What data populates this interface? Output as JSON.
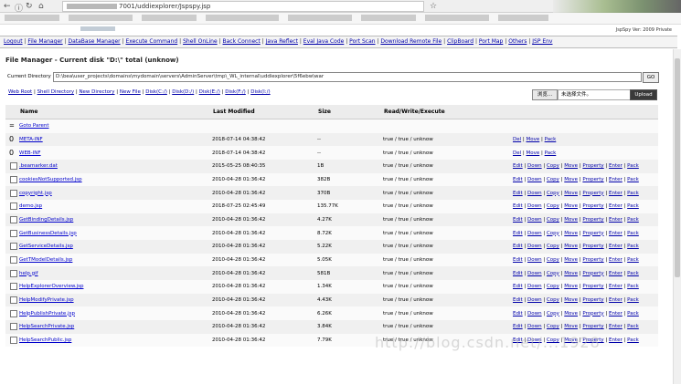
{
  "browser": {
    "url_suffix": "7001/uddiexplorer/Jspspy.jsp",
    "back_icon": "back-arrow-icon",
    "refresh_icon": "refresh-icon",
    "home_icon": "home-icon"
  },
  "page": {
    "blurred_link": "jspy",
    "version": "JspSpy Ver: 2009 Private"
  },
  "menu": [
    "Logout",
    "File Manager",
    "DataBase Manager",
    "Execute Command",
    "Shell OnLine",
    "Back Connect",
    "Java Reflect",
    "Eval Java Code",
    "Port Scan",
    "Download Remote File",
    "ClipBoard",
    "Port Map",
    "Others",
    "JSP Env"
  ],
  "file_manager": {
    "title": "File Manager - Current disk \"D:\\\" total (unknow)",
    "current_directory_label": "Current Directory",
    "current_directory_value": "D:\\bea\\user_projects\\domains\\mydomain\\servers\\AdminServer\\tmp\\_WL_internal\\uddiexplorer\\5f6ebw\\war",
    "go_label": "GO",
    "toolbar": [
      "Web Root",
      "Shell Directory",
      "New Directory",
      "New File",
      "Disk(C:/)",
      "Disk(D:/)",
      "Disk(E:/)",
      "Disk(F:/)",
      "Disk(I:/)"
    ],
    "browse_label": "浏览...",
    "file_input_placeholder": "未选择文件。",
    "upload_label": "Upload",
    "columns": {
      "name": "Name",
      "modified": "Last Modified",
      "size": "Size",
      "rwe": "Read/Write/Execute"
    },
    "parent_label": "Goto Parent",
    "rows": [
      {
        "type": "dir",
        "name": "META-INF",
        "modified": "2018-07-14 04:38:42",
        "size": "--",
        "rwe": "true / true / unknow"
      },
      {
        "type": "dir",
        "name": "WEB-INF",
        "modified": "2018-07-14 04:38:42",
        "size": "--",
        "rwe": "true / true / unknow"
      },
      {
        "type": "file",
        "name": ".beamarker.dat",
        "modified": "2015-05-25 08:40:35",
        "size": "1B",
        "rwe": "true / true / unknow"
      },
      {
        "type": "file",
        "name": "cookiesNotSupported.jsp",
        "modified": "2010-04-28 01:36:42",
        "size": "382B",
        "rwe": "true / true / unknow"
      },
      {
        "type": "file",
        "name": "copyright.jsp",
        "modified": "2010-04-28 01:36:42",
        "size": "370B",
        "rwe": "true / true / unknow"
      },
      {
        "type": "file",
        "name": "demo.jsp",
        "modified": "2018-07-25 02:45:49",
        "size": "135.77K",
        "rwe": "true / true / unknow"
      },
      {
        "type": "file",
        "name": "GetBindingDetails.jsp",
        "modified": "2010-04-28 01:36:42",
        "size": "4.27K",
        "rwe": "true / true / unknow"
      },
      {
        "type": "file",
        "name": "GetBusinessDetails.jsp",
        "modified": "2010-04-28 01:36:42",
        "size": "8.72K",
        "rwe": "true / true / unknow"
      },
      {
        "type": "file",
        "name": "GetServiceDetails.jsp",
        "modified": "2010-04-28 01:36:42",
        "size": "5.22K",
        "rwe": "true / true / unknow"
      },
      {
        "type": "file",
        "name": "GetTModelDetails.jsp",
        "modified": "2010-04-28 01:36:42",
        "size": "5.05K",
        "rwe": "true / true / unknow"
      },
      {
        "type": "file",
        "name": "help.gif",
        "modified": "2010-04-28 01:36:42",
        "size": "581B",
        "rwe": "true / true / unknow"
      },
      {
        "type": "file",
        "name": "HelpExplorerOverview.jsp",
        "modified": "2010-04-28 01:36:42",
        "size": "1.34K",
        "rwe": "true / true / unknow"
      },
      {
        "type": "file",
        "name": "HelpModifyPrivate.jsp",
        "modified": "2010-04-28 01:36:42",
        "size": "4.43K",
        "rwe": "true / true / unknow"
      },
      {
        "type": "file",
        "name": "HelpPublishPrivate.jsp",
        "modified": "2010-04-28 01:36:42",
        "size": "6.26K",
        "rwe": "true / true / unknow"
      },
      {
        "type": "file",
        "name": "HelpSearchPrivate.jsp",
        "modified": "2010-04-28 01:36:42",
        "size": "3.84K",
        "rwe": "true / true / unknow"
      },
      {
        "type": "file",
        "name": "HelpSearchPublic.jsp",
        "modified": "2010-04-28 01:36:42",
        "size": "7.79K",
        "rwe": "true / true / unknow"
      }
    ],
    "dir_actions": [
      "Del",
      "Move",
      "Pack"
    ],
    "file_actions": [
      "Edit",
      "Down",
      "Copy",
      "Move",
      "Property",
      "Enter",
      "Pack"
    ]
  },
  "watermark": "http://blog.csdn.net/...1928"
}
